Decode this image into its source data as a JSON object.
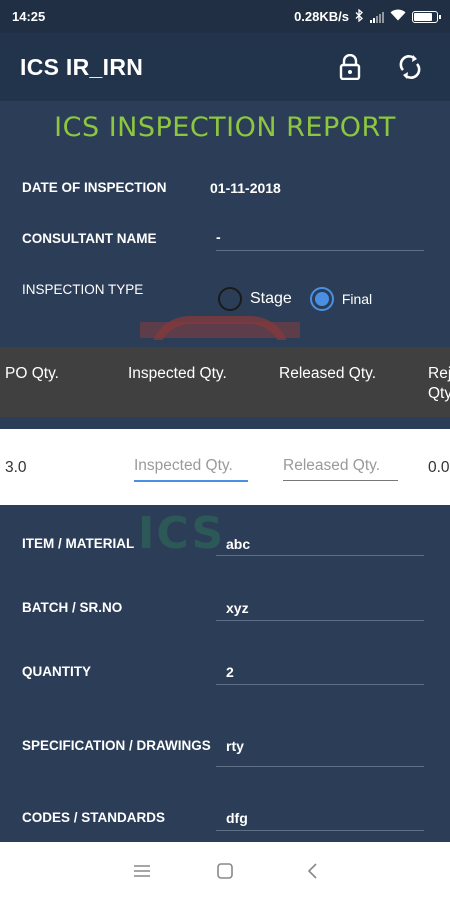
{
  "status_bar": {
    "time": "14:25",
    "speed": "0.28KB/s"
  },
  "app_bar": {
    "title": "ICS IR_IRN",
    "icons": [
      "lock-icon",
      "sync-icon"
    ]
  },
  "report": {
    "title": "ICS INSPECTION REPORT"
  },
  "header_fields": {
    "date_label": "DATE OF INSPECTION",
    "date_value": "01-11-2018",
    "consultant_label": "CONSULTANT NAME",
    "consultant_value": "-",
    "inspection_type_label": "INSPECTION TYPE",
    "options": [
      {
        "label": "Stage",
        "selected": false
      },
      {
        "label": "Final",
        "selected": true
      }
    ]
  },
  "table": {
    "headers": [
      "PO Qty.",
      "Inspected Qty.",
      "Released Qty.",
      "Rej",
      "Qty"
    ],
    "row": {
      "po_qty": "3.0",
      "inspected_placeholder": "Inspected Qty.",
      "released_placeholder": "Released Qty.",
      "rejected": "0.0"
    }
  },
  "details": [
    {
      "label": "ITEM / MATERIAL",
      "value": "abc"
    },
    {
      "label": "BATCH / SR.NO",
      "value": "xyz"
    },
    {
      "label": "QUANTITY",
      "value": "2"
    },
    {
      "label": "SPECIFICATION / DRAWINGS",
      "value": "rty"
    },
    {
      "label": "CODES / STANDARDS",
      "value": "dfg"
    }
  ],
  "colors": {
    "background": "#2c3e57",
    "app_bar": "#22344c",
    "title_green": "#8dc63f",
    "accent_blue": "#4a90e2",
    "table_header": "#404040"
  }
}
